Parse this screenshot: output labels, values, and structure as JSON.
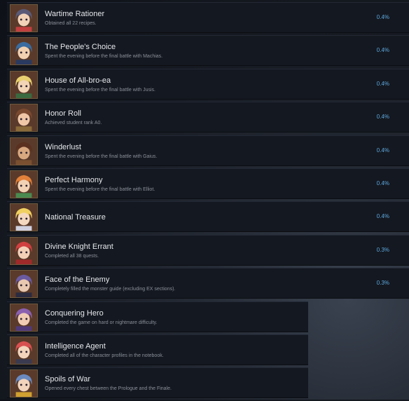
{
  "achievements": [
    {
      "title": "Wartime Rationer",
      "desc": "Obtained all 22 recipes.",
      "pct": "0.4%",
      "hair": "#5a5a78",
      "skin": "#f2d2b8",
      "accent": "#c24040"
    },
    {
      "title": "The People's Choice",
      "desc": "Spent the evening before the final battle with Machias.",
      "pct": "0.4%",
      "hair": "#3a6ca0",
      "skin": "#f0d0b0",
      "accent": "#2a3a60"
    },
    {
      "title": "House of All-bro-ea",
      "desc": "Spent the evening before the final battle with Jusis.",
      "pct": "0.4%",
      "hair": "#e8d070",
      "skin": "#f2d4b6",
      "accent": "#3a6a40"
    },
    {
      "title": "Honor Roll",
      "desc": "Achieved student rank A0.",
      "pct": "0.4%",
      "hair": "#7a4a30",
      "skin": "#f0c8a8",
      "accent": "#8a6a3a"
    },
    {
      "title": "Winderlust",
      "desc": "Spent the evening before the final battle with Gaius.",
      "pct": "0.4%",
      "hair": "#5a3020",
      "skin": "#d8a880",
      "accent": "#7a5030"
    },
    {
      "title": "Perfect Harmony",
      "desc": "Spent the evening before the final battle with Elliot.",
      "pct": "0.4%",
      "hair": "#e0803a",
      "skin": "#f2d2b4",
      "accent": "#4a8a50"
    },
    {
      "title": "National Treasure",
      "desc": "",
      "pct": "0.4%",
      "hair": "#f0d060",
      "skin": "#f4d8c0",
      "accent": "#d0d0e0"
    },
    {
      "title": "Divine Knight Errant",
      "desc": "Completed all 38 quests.",
      "pct": "0.3%",
      "hair": "#d04040",
      "skin": "#f2d0b8",
      "accent": "#a02a2a"
    },
    {
      "title": "Face of the Enemy",
      "desc": "Completely filled the monster guide (excluding EX sections).",
      "pct": "0.3%",
      "hair": "#6a5aa0",
      "skin": "#e8c8b0",
      "accent": "#2a2a40"
    },
    {
      "title": "Conquering Hero",
      "desc": "Completed the game on hard or nightmare difficulty.",
      "pct": "",
      "hair": "#8a60b0",
      "skin": "#f0ccb4",
      "accent": "#503a7a"
    },
    {
      "title": "Intelligence Agent",
      "desc": "Completed all of the character profiles in the notebook.",
      "pct": "",
      "hair": "#d85050",
      "skin": "#f2d4bc",
      "accent": "#3a3a50"
    },
    {
      "title": "Spoils of War",
      "desc": "Opened every chest between the Prologue and the Finale.",
      "pct": "",
      "hair": "#6a8ac0",
      "skin": "#f2d4bc",
      "accent": "#d0a030"
    }
  ]
}
